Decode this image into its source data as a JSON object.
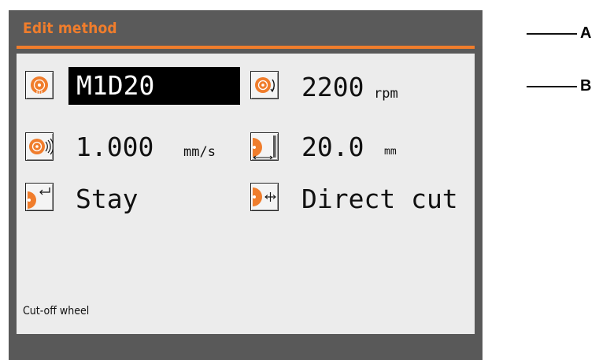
{
  "header": {
    "title": "Edit method"
  },
  "method": {
    "name": "M1D20",
    "speed": {
      "value": "2200",
      "unit": "rpm"
    },
    "feed": {
      "value": "1.000",
      "unit": "mm/s"
    },
    "cut_length": {
      "value": "20.0",
      "unit": "mm"
    },
    "end_position": {
      "value": "Stay"
    },
    "cut_mode": {
      "value": "Direct cut"
    }
  },
  "footer": {
    "label": "Cut-off wheel"
  },
  "callouts": {
    "a": "A",
    "b": "B"
  },
  "colors": {
    "accent": "#f07d2c",
    "frame": "#595959",
    "screen": "#ececec"
  },
  "icons": {
    "wheel": "cut-off-wheel-icon",
    "speed": "rotation-speed-icon",
    "feed": "feed-speed-icon",
    "cut_length": "cut-length-icon",
    "end_position": "end-position-icon",
    "cut_mode": "cut-mode-icon"
  }
}
